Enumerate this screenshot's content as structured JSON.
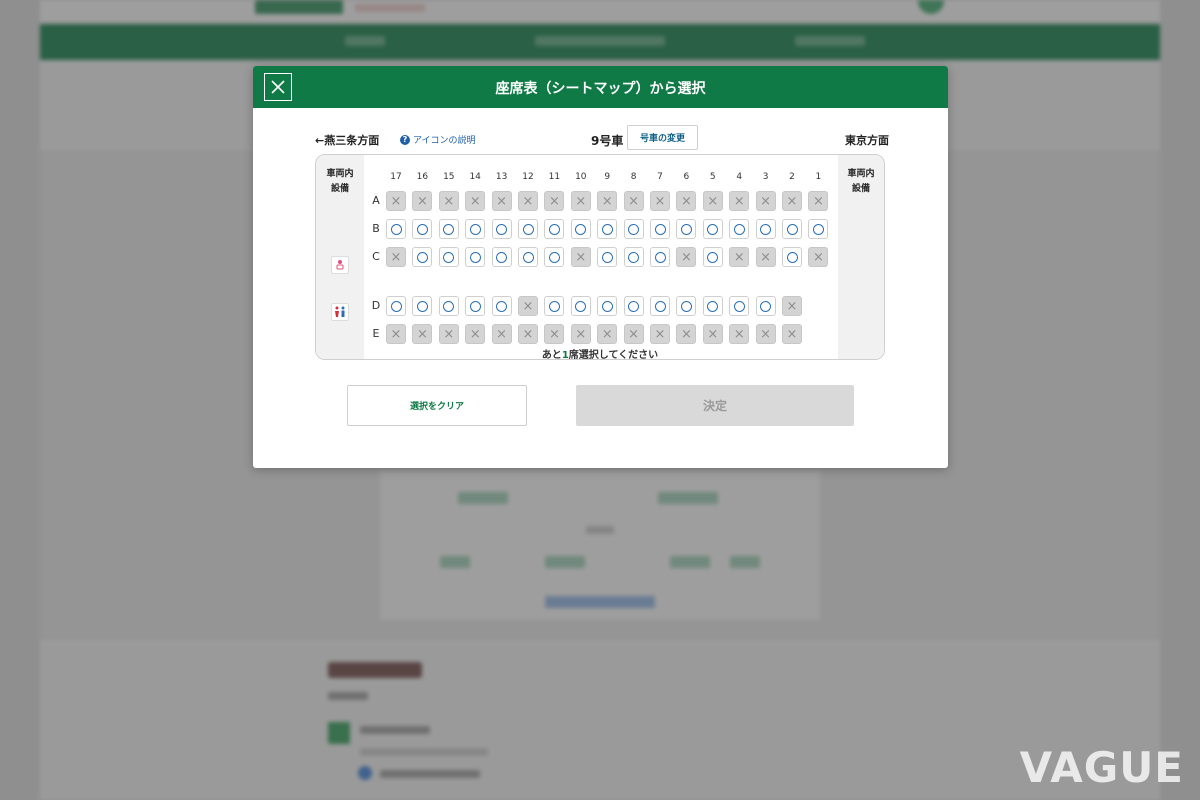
{
  "modal": {
    "title": "座席表（シートマップ）から選択",
    "direction_left": "←燕三条方面",
    "icon_help": "アイコンの説明",
    "car_number": "9号車",
    "car_change": "号車の変更",
    "direction_right": "東京方面",
    "facility_label_left": "車両内\n設備",
    "facility_label_right": "車両内\n設備",
    "columns": [
      "17",
      "16",
      "15",
      "14",
      "13",
      "12",
      "11",
      "10",
      "9",
      "8",
      "7",
      "6",
      "5",
      "4",
      "3",
      "2",
      "1"
    ],
    "rows": [
      {
        "label": "A",
        "seats": [
          "x",
          "x",
          "x",
          "x",
          "x",
          "x",
          "x",
          "x",
          "x",
          "x",
          "x",
          "x",
          "x",
          "x",
          "x",
          "x",
          "x"
        ]
      },
      {
        "label": "B",
        "seats": [
          "o",
          "o",
          "o",
          "o",
          "o",
          "o",
          "o",
          "o",
          "o",
          "o",
          "o",
          "o",
          "o",
          "o",
          "o",
          "o",
          "o"
        ]
      },
      {
        "label": "C",
        "seats": [
          "x",
          "o",
          "o",
          "o",
          "o",
          "o",
          "o",
          "x",
          "o",
          "o",
          "o",
          "x",
          "o",
          "x",
          "x",
          "o",
          "x"
        ]
      },
      {
        "label": "D",
        "seats": [
          "o",
          "o",
          "o",
          "o",
          "o",
          "x",
          "o",
          "o",
          "o",
          "o",
          "o",
          "o",
          "o",
          "o",
          "o",
          "x"
        ]
      },
      {
        "label": "E",
        "seats": [
          "x",
          "x",
          "x",
          "x",
          "x",
          "x",
          "x",
          "x",
          "x",
          "x",
          "x",
          "x",
          "x",
          "x",
          "x",
          "x"
        ]
      }
    ],
    "hint_prefix": "あと",
    "hint_count": "1",
    "hint_suffix": "席選択してください",
    "clear_button": "選択をクリア",
    "decide_button": "決定"
  },
  "watermark": "VAGUE",
  "colors": {
    "brand_green": "#0f7a45",
    "available_circle": "#2a6fb5",
    "taken_seat": "#d4d4d4"
  },
  "icons": {
    "close": "close-icon",
    "help": "help-icon",
    "facility_1": "nursery-room-icon",
    "facility_2": "restroom-icon"
  }
}
